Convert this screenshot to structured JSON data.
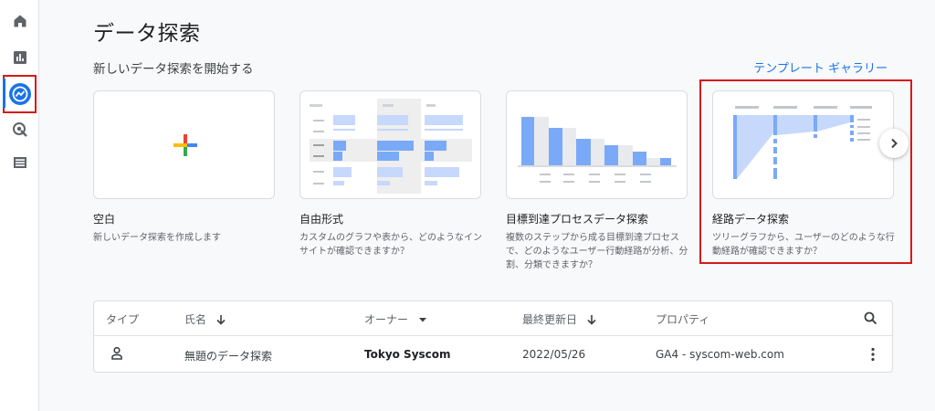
{
  "rail": {
    "items": [
      {
        "icon": "home-icon"
      },
      {
        "icon": "reports-icon"
      },
      {
        "icon": "explore-icon",
        "active": true
      },
      {
        "icon": "advertising-icon"
      },
      {
        "icon": "configure-icon"
      }
    ]
  },
  "page": {
    "title": "データ探索",
    "subtitle": "新しいデータ探索を開始する",
    "gallery_link": "テンプレート ギャラリー"
  },
  "templates": [
    {
      "title": "空白",
      "desc": "新しいデータ探索を作成します"
    },
    {
      "title": "自由形式",
      "desc": "カスタムのグラフや表から、どのようなインサイトが確認できますか？"
    },
    {
      "title": "目標到達プロセスデータ探索",
      "desc": "複数のステップから成る目標到達プロセスで、どのようなユーザー行動経路が分析、分割、分類できますか？"
    },
    {
      "title": "経路データ探索",
      "desc": "ツリーグラフから、ユーザーのどのような行動経路が確認できますか？"
    }
  ],
  "table": {
    "headers": {
      "type": "タイプ",
      "name": "氏名",
      "owner": "オーナー",
      "modified": "最終更新日",
      "property": "プロパティ"
    },
    "rows": [
      {
        "name": "無題のデータ探索",
        "owner": "Tokyo Syscom",
        "modified": "2022/05/26",
        "property": "GA4 - syscom-web.com"
      }
    ]
  },
  "colors": {
    "accent": "#1a73e8",
    "highlight": "#d61a1a"
  }
}
